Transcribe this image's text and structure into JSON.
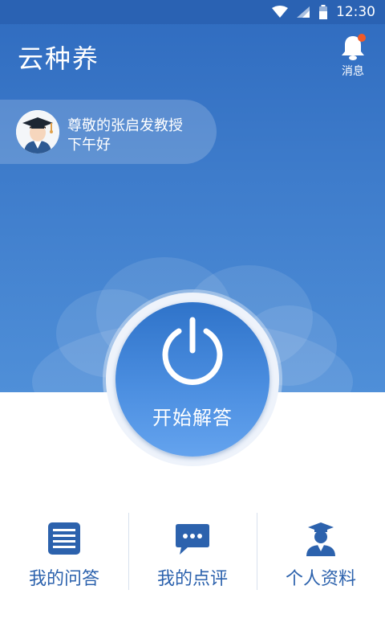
{
  "status_bar": {
    "time": "12:30",
    "icons": [
      "wifi-icon",
      "signal-icon",
      "battery-icon"
    ]
  },
  "header": {
    "title": "云种养",
    "messages_label": "消息",
    "has_unread": true
  },
  "greeting": {
    "line1": "尊敬的张启发教授",
    "line2": "下午好",
    "avatar": "graduate-avatar"
  },
  "start": {
    "label": "开始解答",
    "icon": "power-icon"
  },
  "nav": [
    {
      "label": "我的问答",
      "icon": "list-icon"
    },
    {
      "label": "我的点评",
      "icon": "chat-bubble-icon"
    },
    {
      "label": "个人资料",
      "icon": "graduate-icon"
    }
  ],
  "colors": {
    "primary": "#3e7ccb",
    "accent": "#2c62ad",
    "notify": "#f05a28",
    "status_bar": "#2a62b3"
  }
}
